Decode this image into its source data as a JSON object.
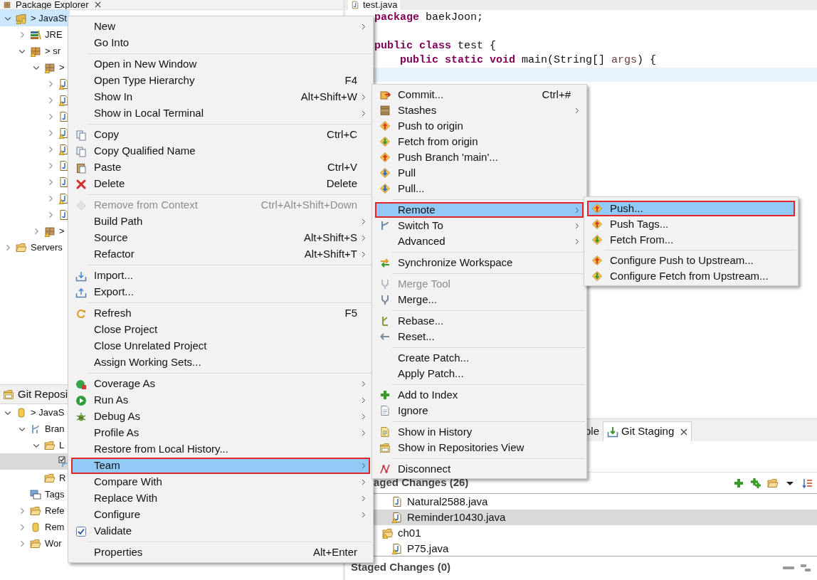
{
  "package_explorer": {
    "title": "Package Explorer",
    "focused": true,
    "tree": [
      {
        "label": "> JavaSt",
        "kind": "project",
        "warning": true,
        "expanded": true,
        "selected": true,
        "children": [
          {
            "label": "JRE",
            "kind": "library",
            "warning": false,
            "expanded": false,
            "selected": false
          },
          {
            "label": "> sr",
            "kind": "package-root",
            "warning": true,
            "expanded": true,
            "selected": false,
            "children": [
              {
                "label": ">",
                "kind": "package",
                "warning": true,
                "expanded": true,
                "selected": false,
                "children": [
                  {
                    "kind": "java",
                    "warning": true,
                    "expanded": false,
                    "selected": false
                  },
                  {
                    "kind": "java",
                    "warning": true,
                    "expanded": false,
                    "selected": false
                  },
                  {
                    "kind": "java",
                    "warning": false,
                    "expanded": false,
                    "selected": false
                  },
                  {
                    "kind": "java",
                    "warning": true,
                    "expanded": false,
                    "selected": false
                  },
                  {
                    "kind": "java",
                    "warning": true,
                    "expanded": false,
                    "selected": false
                  },
                  {
                    "kind": "java",
                    "warning": false,
                    "expanded": false,
                    "selected": false
                  },
                  {
                    "kind": "java",
                    "warning": false,
                    "expanded": false,
                    "selected": false
                  },
                  {
                    "kind": "java",
                    "warning": true,
                    "expanded": false,
                    "selected": false
                  },
                  {
                    "kind": "java",
                    "warning": false,
                    "expanded": false,
                    "selected": false
                  }
                ]
              },
              {
                "label": ">",
                "kind": "package",
                "warning": true,
                "expanded": false,
                "selected": false
              }
            ]
          }
        ]
      },
      {
        "label": "Servers",
        "kind": "folder",
        "warning": false,
        "expanded": false,
        "selected": false
      }
    ]
  },
  "git_repositories": {
    "title": "Git Reposi",
    "focused": false,
    "tree": [
      {
        "label": "> JavaS",
        "kind": "repo",
        "warning": false,
        "expanded": true,
        "selected": false,
        "children": [
          {
            "label": "Bran",
            "kind": "branches",
            "warning": false,
            "expanded": true,
            "selected": false,
            "children": [
              {
                "label": "L",
                "kind": "folder",
                "warning": false,
                "expanded": true,
                "selected": false,
                "children": [
                  {
                    "kind": "branch",
                    "warning": false,
                    "selected": true
                  }
                ]
              },
              {
                "label": "R",
                "kind": "folder",
                "warning": false,
                "selected": false
              }
            ]
          },
          {
            "label": "Tags",
            "kind": "tags",
            "warning": false,
            "selected": false
          },
          {
            "label": "Refe",
            "kind": "folder",
            "warning": false,
            "expanded": false,
            "selected": false
          },
          {
            "label": "Rem",
            "kind": "repo",
            "warning": false,
            "expanded": false,
            "selected": false
          },
          {
            "label": "Wor",
            "kind": "folder",
            "warning": false,
            "expanded": false,
            "selected": false
          }
        ]
      }
    ]
  },
  "editor": {
    "tab": {
      "label": "test.java"
    },
    "lines": [
      {
        "current": false,
        "tokens": [
          {
            "text": "package",
            "kind": "keyword"
          },
          {
            "text": " baekJoon;",
            "kind": "plain"
          }
        ]
      },
      {
        "current": false
      },
      {
        "current": false,
        "tokens": [
          {
            "text": "public",
            "kind": "keyword"
          },
          {
            "text": " class",
            "kind": "keyword"
          },
          {
            "text": " test {",
            "kind": "plain"
          }
        ]
      },
      {
        "current": false,
        "tokens": [
          {
            "text": "    public",
            "kind": "keyword"
          },
          {
            "text": " static",
            "kind": "keyword"
          },
          {
            "text": " void",
            "kind": "keyword"
          },
          {
            "text": " main(String[] ",
            "kind": "plain"
          },
          {
            "text": "args",
            "kind": "param"
          },
          {
            "text": ") {",
            "kind": "plain"
          }
        ]
      },
      {
        "current": true
      }
    ]
  },
  "staging": {
    "tabs": [
      {
        "label": "ole",
        "selected": false,
        "closable": false
      },
      {
        "label": "Git Staging",
        "selected": true,
        "closable": true
      }
    ],
    "unstaged": {
      "title": "aged Changes (26)",
      "files": [
        {
          "label": "Natural2588.java",
          "kind": "java",
          "warning": false,
          "selected": false
        },
        {
          "label": "Reminder10430.java",
          "kind": "java",
          "warning": true,
          "selected": true
        },
        {
          "label": "ch01",
          "kind": "folder",
          "warning": true,
          "selected": false,
          "children": [
            {
              "label": "P75.java",
              "kind": "java",
              "warning": true,
              "selected": false
            }
          ]
        }
      ]
    },
    "staged": {
      "title": "Staged Changes (0)"
    }
  },
  "context_menu": {
    "items": [
      {
        "kind": "plain",
        "label": "New",
        "submenu": true,
        "disabled": false,
        "selected": false
      },
      {
        "kind": "plain",
        "label": "Go Into",
        "submenu": false,
        "disabled": false,
        "selected": false
      },
      {
        "kind": "separator"
      },
      {
        "kind": "plain",
        "label": "Open in New Window",
        "submenu": false,
        "disabled": false,
        "selected": false
      },
      {
        "kind": "plain",
        "label": "Open Type Hierarchy",
        "shortcut": "F4",
        "submenu": false,
        "disabled": false,
        "selected": false
      },
      {
        "kind": "plain",
        "label": "Show In",
        "shortcut": "Alt+Shift+W",
        "submenu": true,
        "disabled": false,
        "selected": false
      },
      {
        "kind": "plain",
        "label": "Show in Local Terminal",
        "submenu": true,
        "disabled": false,
        "selected": false
      },
      {
        "kind": "separator"
      },
      {
        "kind": "copy",
        "label": "Copy",
        "shortcut": "Ctrl+C",
        "submenu": false,
        "disabled": false,
        "selected": false
      },
      {
        "kind": "copy",
        "label": "Copy Qualified Name",
        "submenu": false,
        "disabled": false,
        "selected": false
      },
      {
        "kind": "paste",
        "label": "Paste",
        "shortcut": "Ctrl+V",
        "submenu": false,
        "disabled": false,
        "selected": false
      },
      {
        "kind": "delete",
        "label": "Delete",
        "shortcut": "Delete",
        "submenu": false,
        "disabled": false,
        "selected": false
      },
      {
        "kind": "separator"
      },
      {
        "kind": "context",
        "label": "Remove from Context",
        "shortcut": "Ctrl+Alt+Shift+Down",
        "submenu": false,
        "disabled": true,
        "selected": false
      },
      {
        "kind": "plain",
        "label": "Build Path",
        "submenu": true,
        "disabled": false,
        "selected": false
      },
      {
        "kind": "plain",
        "label": "Source",
        "shortcut": "Alt+Shift+S",
        "submenu": true,
        "disabled": false,
        "selected": false
      },
      {
        "kind": "plain",
        "label": "Refactor",
        "shortcut": "Alt+Shift+T",
        "submenu": true,
        "disabled": false,
        "selected": false
      },
      {
        "kind": "separator"
      },
      {
        "kind": "import",
        "label": "Import...",
        "submenu": false,
        "disabled": false,
        "selected": false
      },
      {
        "kind": "export",
        "label": "Export...",
        "submenu": false,
        "disabled": false,
        "selected": false
      },
      {
        "kind": "separator"
      },
      {
        "kind": "refresh",
        "label": "Refresh",
        "shortcut": "F5",
        "submenu": false,
        "disabled": false,
        "selected": false
      },
      {
        "kind": "plain",
        "label": "Close Project",
        "submenu": false,
        "disabled": false,
        "selected": false
      },
      {
        "kind": "plain",
        "label": "Close Unrelated Project",
        "submenu": false,
        "disabled": false,
        "selected": false
      },
      {
        "kind": "plain",
        "label": "Assign Working Sets...",
        "submenu": false,
        "disabled": false,
        "selected": false
      },
      {
        "kind": "separator"
      },
      {
        "kind": "coverage",
        "label": "Coverage As",
        "submenu": true,
        "disabled": false,
        "selected": false
      },
      {
        "kind": "run",
        "label": "Run As",
        "submenu": true,
        "disabled": false,
        "selected": false
      },
      {
        "kind": "debug",
        "label": "Debug As",
        "submenu": true,
        "disabled": false,
        "selected": false
      },
      {
        "kind": "plain",
        "label": "Profile As",
        "submenu": true,
        "disabled": false,
        "selected": false
      },
      {
        "kind": "plain",
        "label": "Restore from Local History...",
        "submenu": false,
        "disabled": false,
        "selected": false
      },
      {
        "kind": "plain",
        "label": "Team",
        "submenu": true,
        "disabled": false,
        "selected": true
      },
      {
        "kind": "plain",
        "label": "Compare With",
        "submenu": true,
        "disabled": false,
        "selected": false
      },
      {
        "kind": "plain",
        "label": "Replace With",
        "submenu": true,
        "disabled": false,
        "selected": false
      },
      {
        "kind": "plain",
        "label": "Configure",
        "submenu": true,
        "disabled": false,
        "selected": false
      },
      {
        "kind": "check",
        "label": "Validate",
        "submenu": false,
        "disabled": false,
        "selected": false
      },
      {
        "kind": "separator"
      },
      {
        "kind": "plain",
        "label": "Properties",
        "shortcut": "Alt+Enter",
        "submenu": false,
        "disabled": false,
        "selected": false
      }
    ]
  },
  "team_submenu": {
    "items": [
      {
        "kind": "commit",
        "label": "Commit...",
        "shortcut": "Ctrl+#",
        "submenu": false,
        "disabled": false,
        "selected": false
      },
      {
        "kind": "stash",
        "label": "Stashes",
        "submenu": true,
        "disabled": false,
        "selected": false
      },
      {
        "kind": "push",
        "label": "Push to origin",
        "submenu": false,
        "disabled": false,
        "selected": false
      },
      {
        "kind": "fetch",
        "label": "Fetch from origin",
        "submenu": false,
        "disabled": false,
        "selected": false
      },
      {
        "kind": "push",
        "label": "Push Branch 'main'...",
        "submenu": false,
        "disabled": false,
        "selected": false
      },
      {
        "kind": "pull",
        "label": "Pull",
        "submenu": false,
        "disabled": false,
        "selected": false
      },
      {
        "kind": "pull",
        "label": "Pull...",
        "submenu": false,
        "disabled": false,
        "selected": false
      },
      {
        "kind": "separator"
      },
      {
        "kind": "plain",
        "label": "Remote",
        "submenu": true,
        "disabled": false,
        "selected": true
      },
      {
        "kind": "branch",
        "label": "Switch To",
        "submenu": true,
        "disabled": false,
        "selected": false
      },
      {
        "kind": "plain",
        "label": "Advanced",
        "submenu": true,
        "disabled": false,
        "selected": false
      },
      {
        "kind": "separator"
      },
      {
        "kind": "sync",
        "label": "Synchronize Workspace",
        "submenu": false,
        "disabled": false,
        "selected": false
      },
      {
        "kind": "separator"
      },
      {
        "kind": "merge",
        "label": "Merge Tool",
        "submenu": false,
        "disabled": true,
        "selected": false
      },
      {
        "kind": "merge",
        "label": "Merge...",
        "submenu": false,
        "disabled": false,
        "selected": false
      },
      {
        "kind": "separator"
      },
      {
        "kind": "rebase",
        "label": "Rebase...",
        "submenu": false,
        "disabled": false,
        "selected": false
      },
      {
        "kind": "reset",
        "label": "Reset...",
        "submenu": false,
        "disabled": false,
        "selected": false
      },
      {
        "kind": "separator"
      },
      {
        "kind": "plain",
        "label": "Create Patch...",
        "submenu": false,
        "disabled": false,
        "selected": false
      },
      {
        "kind": "plain",
        "label": "Apply Patch...",
        "submenu": false,
        "disabled": false,
        "selected": false
      },
      {
        "kind": "separator"
      },
      {
        "kind": "add",
        "label": "Add to Index",
        "submenu": false,
        "disabled": false,
        "selected": false
      },
      {
        "kind": "ignore",
        "label": "Ignore",
        "submenu": false,
        "disabled": false,
        "selected": false
      },
      {
        "kind": "separator"
      },
      {
        "kind": "history",
        "label": "Show in History",
        "submenu": false,
        "disabled": false,
        "selected": false
      },
      {
        "kind": "repos",
        "label": "Show in Repositories View",
        "submenu": false,
        "disabled": false,
        "selected": false
      },
      {
        "kind": "separator"
      },
      {
        "kind": "disconnect",
        "label": "Disconnect",
        "submenu": false,
        "disabled": false,
        "selected": false
      }
    ]
  },
  "remote_submenu": {
    "items": [
      {
        "kind": "push",
        "label": "Push...",
        "submenu": false,
        "disabled": false,
        "selected": true
      },
      {
        "kind": "push",
        "label": "Push Tags...",
        "submenu": false,
        "disabled": false,
        "selected": false
      },
      {
        "kind": "fetch",
        "label": "Fetch From...",
        "submenu": false,
        "disabled": false,
        "selected": false
      },
      {
        "kind": "separator"
      },
      {
        "kind": "push",
        "label": "Configure Push to Upstream...",
        "submenu": false,
        "disabled": false,
        "selected": false
      },
      {
        "kind": "fetch",
        "label": "Configure Fetch from Upstream...",
        "submenu": false,
        "disabled": false,
        "selected": false
      }
    ]
  }
}
